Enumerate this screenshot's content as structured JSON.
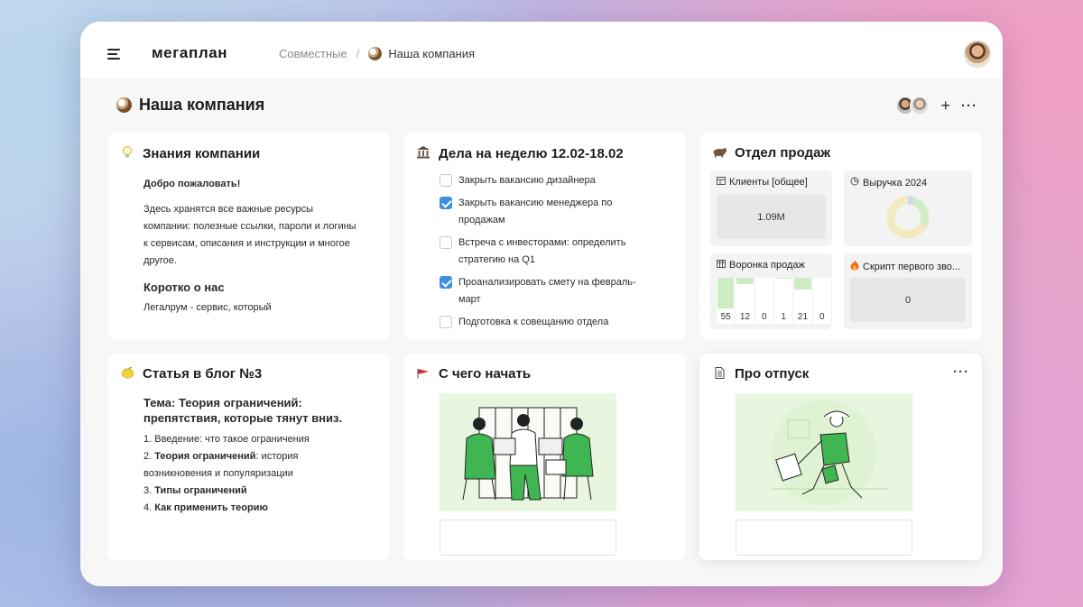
{
  "header": {
    "logo": "мегаплан",
    "breadcrumb": {
      "parent": "Совместные",
      "separator": "/",
      "current": "Наша компания"
    }
  },
  "page": {
    "title": "Наша компания"
  },
  "cards": {
    "knowledge": {
      "title": "Знания компании",
      "icon": "lightbulb-icon",
      "welcome": "Добро пожаловать!",
      "intro": "Здесь хранятся все важные ресурсы компании: полезные ссылки, пароли и логины к сервисам, описания и инструкции и многое другое.",
      "about_heading": "Коротко о нас",
      "about_text": "Легалрум - сервис, который"
    },
    "tasks": {
      "title": "Дела на неделю 12.02-18.02",
      "icon": "bank-icon",
      "items": [
        {
          "text": "Закрыть вакансию дизайнера",
          "checked": false
        },
        {
          "text": "Закрыть вакансию менеджера по продажам",
          "checked": true
        },
        {
          "text": "Встреча с инвесторами: определить стратегию на Q1",
          "checked": false
        },
        {
          "text": "Проанализировать смету на февраль-март",
          "checked": true
        },
        {
          "text": "Подготовка к совещанию отдела",
          "checked": false
        }
      ]
    },
    "sales": {
      "title": "Отдел продаж",
      "icon": "bear-icon",
      "widgets": {
        "clients": {
          "title": "Клиенты [общее]",
          "value": "1.09M",
          "icon": "table-icon"
        },
        "revenue": {
          "title": "Выручка 2024",
          "icon": "pie-chart-icon"
        },
        "funnel": {
          "title": "Воронка продаж",
          "icon": "grid-icon",
          "values": [
            55,
            12,
            0,
            1,
            21,
            0
          ],
          "max": 55
        },
        "script": {
          "title": "Скрипт первого зво...",
          "value": "0",
          "icon": "fire-icon"
        }
      }
    },
    "blog": {
      "title": "Статья в блог №3",
      "icon": "lemon-icon",
      "topic": "Тема: Теория ограничений: препятствия, которые тянут вниз.",
      "list": [
        {
          "num": "1.",
          "bold": "",
          "text": "Введение: что такое ограничения"
        },
        {
          "num": "2.",
          "bold": "Теория ограничений",
          "text": ": история возникновения и популяризации"
        },
        {
          "num": "3.",
          "bold": "Типы ограничений",
          "text": ""
        },
        {
          "num": "4.",
          "bold": "Как применить теорию",
          "text": ""
        }
      ]
    },
    "start": {
      "title": "С чего начать",
      "icon": "flag-icon"
    },
    "vacation": {
      "title": "Про отпуск",
      "icon": "document-icon",
      "more": "···"
    }
  },
  "actions": {
    "add": "+",
    "more": "···"
  }
}
